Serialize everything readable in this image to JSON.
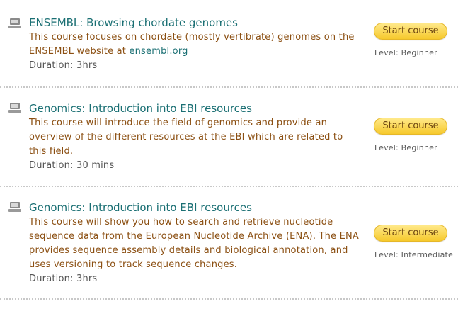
{
  "courses": [
    {
      "title": "ENSEMBL: Browsing chordate genomes",
      "description_text": "This course focuses on chordate (mostly vertibrate) genomes on the ENSEMBL website at ",
      "description_link": "ensembl.org",
      "duration": "Duration: 3hrs",
      "button_label": "Start course",
      "level": "Level: Beginner",
      "icon": "computer-icon"
    },
    {
      "title": "Genomics: Introduction into EBI resources",
      "description_text": "This course will introduce the field of genomics and provide an overview of the different resources at the EBI which are related to this field.",
      "duration": "Duration: 30 mins",
      "button_label": "Start course",
      "level": "Level: Beginner",
      "icon": "computer-icon"
    },
    {
      "title": "Genomics: Introduction into EBI resources",
      "description_text": "This course will show you how to search and retrieve nucleotide sequence data from the European Nucleotide Archive (ENA). The ENA provides sequence assembly details and biological annotation, and uses versioning to track sequence changes.",
      "duration": "Duration: 3hrs",
      "button_label": "Start course",
      "level": "Level: Intermediate",
      "icon": "computer-icon"
    }
  ],
  "colors": {
    "title": "#1a6f73",
    "description": "#8b4f12",
    "button": "#f6c92c"
  }
}
